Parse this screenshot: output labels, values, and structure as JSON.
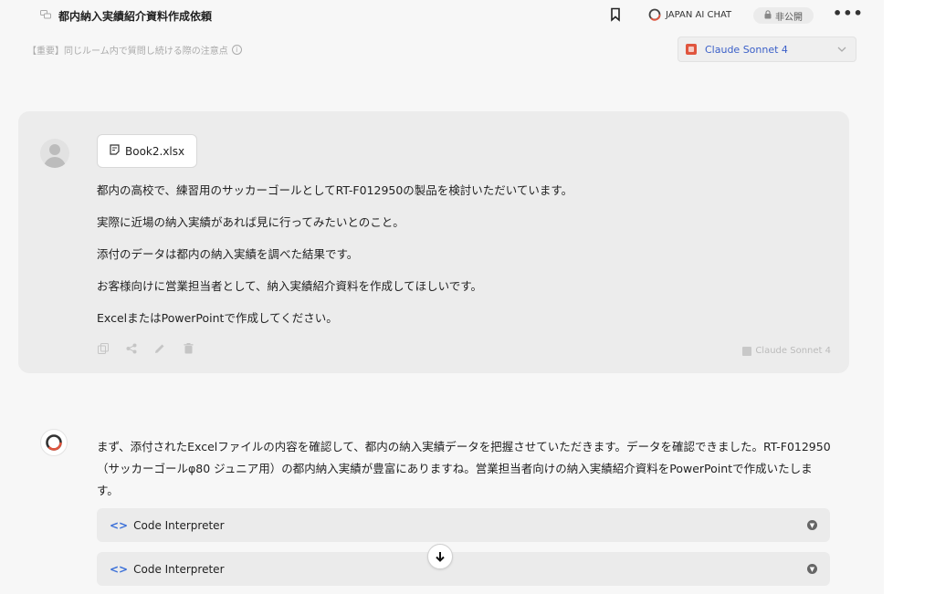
{
  "header": {
    "title": "都内納入実績紹介資料作成依頼",
    "brand_label": "JAPAN AI CHAT",
    "visibility_label": "非公開",
    "more_label": "•••"
  },
  "notice": {
    "text": "【重要】同じルーム内で質問し続ける際の注意点"
  },
  "model_select": {
    "selected": "Claude Sonnet 4"
  },
  "user_message": {
    "attachment_name": "Book2.xlsx",
    "lines": [
      "都内の高校で、練習用のサッカーゴールとしてRT-F012950の製品を検討いただいています。",
      "実際に近場の納入実績があれば見に行ってみたいとのこと。",
      "添付のデータは都内の納入実績を調べた結果です。",
      "お客様向けに営業担当者として、納入実績紹介資料を作成してほしいです。",
      "ExcelまたはPowerPointで作成してください。"
    ],
    "model_label": "Claude Sonnet 4"
  },
  "assistant_message": {
    "text": "まず、添付されたExcelファイルの内容を確認して、都内の納入実績データを把握させていただきます。データを確認できました。RT-F012950（サッカーゴールφ80 ジュニア用）の都内納入実績が豊富にありますね。営業担当者向けの納入実績紹介資料をPowerPointで作成いたします。",
    "tool_panels": [
      {
        "label": "Code Interpreter"
      },
      {
        "label": "Code Interpreter"
      }
    ]
  },
  "colors": {
    "accent_blue": "#3a5fc8",
    "claude_orange": "#e0553e",
    "card_bg": "#ececec",
    "page_bg": "#f7f7f7"
  },
  "icons": [
    "chat-icon",
    "bookmark-icon",
    "japan-ai-logo-icon",
    "lock-icon",
    "info-icon",
    "claude-icon",
    "chevron-down-icon",
    "file-icon",
    "copy-icon",
    "share-icon",
    "edit-icon",
    "trash-icon",
    "model-icon",
    "code-icon",
    "arrow-down-icon"
  ]
}
